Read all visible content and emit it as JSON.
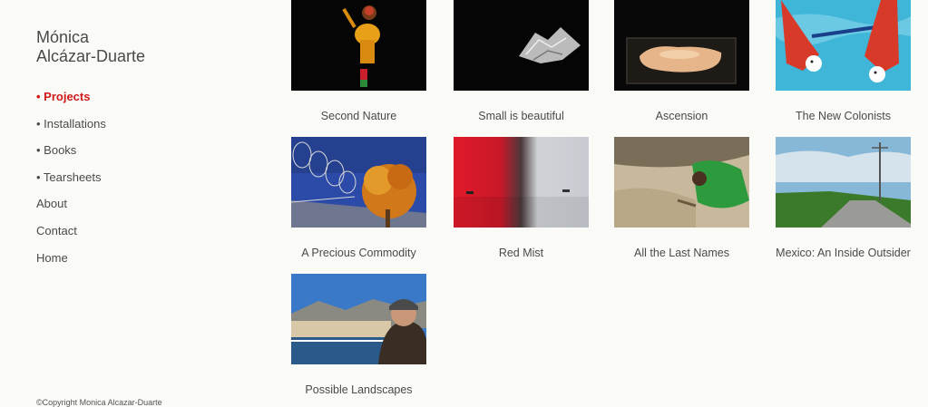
{
  "site": {
    "title": "Mónica\nAlcázar-Duarte",
    "copyright": "©Copyright Monica Alcazar-Duarte"
  },
  "nav": [
    {
      "label": "• Projects",
      "active": true
    },
    {
      "label": "• Installations",
      "active": false
    },
    {
      "label": "• Books",
      "active": false
    },
    {
      "label": "• Tearsheets",
      "active": false
    },
    {
      "label": "About",
      "active": false
    },
    {
      "label": "Contact",
      "active": false
    },
    {
      "label": "Home",
      "active": false
    }
  ],
  "projects": [
    {
      "title": "Second Nature"
    },
    {
      "title": "Small is beautiful"
    },
    {
      "title": "Ascension"
    },
    {
      "title": "The New Colonists"
    },
    {
      "title": "A Precious Commodity"
    },
    {
      "title": "Red Mist"
    },
    {
      "title": "All the Last Names"
    },
    {
      "title": "Mexico: An Inside Outsider"
    },
    {
      "title": "Possible Landscapes"
    }
  ],
  "colors": {
    "accent": "#d0191b",
    "background": "#fafaf7",
    "text": "#4a4a4a"
  }
}
